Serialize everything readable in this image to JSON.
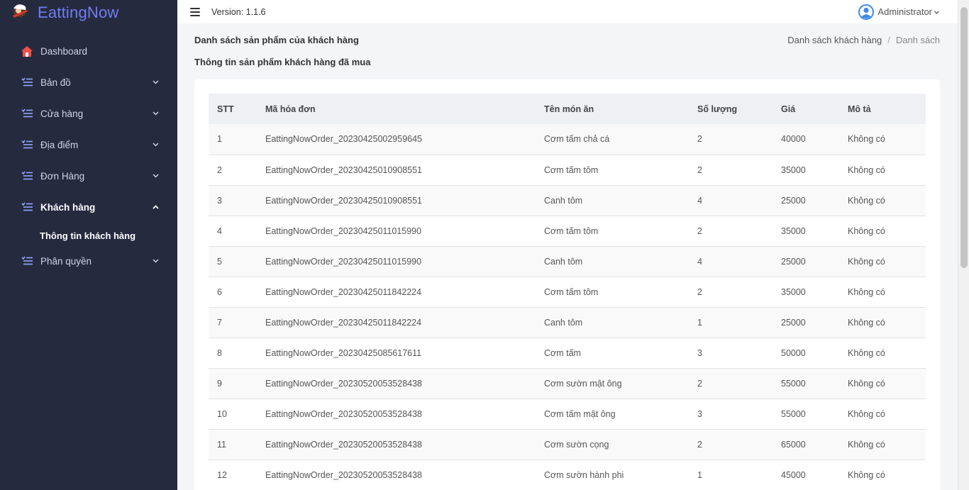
{
  "brand": {
    "name": "EattingNow"
  },
  "sidebar": {
    "items": [
      {
        "label": "Dashboard",
        "icon": "home-icon",
        "has_chevron": false
      },
      {
        "label": "Bản đồ",
        "icon": "list-icon",
        "has_chevron": true
      },
      {
        "label": "Cửa hàng",
        "icon": "list-icon",
        "has_chevron": true
      },
      {
        "label": "Địa điểm",
        "icon": "list-icon",
        "has_chevron": true
      },
      {
        "label": "Đơn Hàng",
        "icon": "list-icon",
        "has_chevron": true
      },
      {
        "label": "Khách hàng",
        "icon": "list-icon",
        "has_chevron": true,
        "expanded": true
      },
      {
        "label": "Phân quyền",
        "icon": "list-icon",
        "has_chevron": true
      }
    ],
    "submenu": {
      "label": "Thông tin khách hàng"
    }
  },
  "header": {
    "version": "Version: 1.1.6",
    "user": "Administrator"
  },
  "page": {
    "title": "Danh sách sản phẩm của khách hàng",
    "breadcrumb": [
      "Danh sách khách hàng",
      "Danh sách"
    ],
    "section_title": "Thông tin sản phẩm khách hàng đã mua"
  },
  "table": {
    "columns": [
      "STT",
      "Mã hóa đơn",
      "Tên món ăn",
      "Số lượng",
      "Giá",
      "Mô tả"
    ],
    "rows": [
      [
        "1",
        "EattingNowOrder_20230425002959645",
        "Cơm tấm chả cá",
        "2",
        "40000",
        "Không có"
      ],
      [
        "2",
        "EattingNowOrder_20230425010908551",
        "Cơm tấm tôm",
        "2",
        "35000",
        "Không có"
      ],
      [
        "3",
        "EattingNowOrder_20230425010908551",
        "Canh tôm",
        "4",
        "25000",
        "Không có"
      ],
      [
        "4",
        "EattingNowOrder_20230425011015990",
        "Cơm tấm tôm",
        "2",
        "35000",
        "Không có"
      ],
      [
        "5",
        "EattingNowOrder_20230425011015990",
        "Canh tôm",
        "4",
        "25000",
        "Không có"
      ],
      [
        "6",
        "EattingNowOrder_20230425011842224",
        "Cơm tấm tôm",
        "2",
        "35000",
        "Không có"
      ],
      [
        "7",
        "EattingNowOrder_20230425011842224",
        "Canh tôm",
        "1",
        "25000",
        "Không có"
      ],
      [
        "8",
        "EattingNowOrder_20230425085617611",
        "Cơm tấm",
        "3",
        "50000",
        "Không có"
      ],
      [
        "9",
        "EattingNowOrder_20230520053528438",
        "Cơm sườn mật ông",
        "2",
        "55000",
        "Không có"
      ],
      [
        "10",
        "EattingNowOrder_20230520053528438",
        "Cơm tấm mật ông",
        "3",
        "55000",
        "Không có"
      ],
      [
        "11",
        "EattingNowOrder_20230520053528438",
        "Cơm sườn cọng",
        "2",
        "65000",
        "Không có"
      ],
      [
        "12",
        "EattingNowOrder_20230520053528438",
        "Cơm sườn hành phi",
        "1",
        "45000",
        "Không có"
      ]
    ]
  },
  "colors": {
    "sidebar_bg": "#262a3f",
    "brand": "#6d7ef2",
    "accent_icon": "#8fa8ff",
    "home_icon": "#f0524a",
    "avatar": "#3d8be8"
  }
}
